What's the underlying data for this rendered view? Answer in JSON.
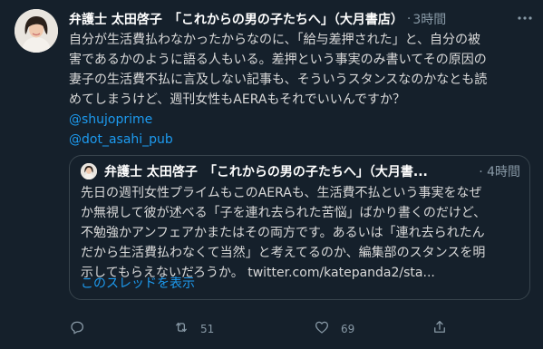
{
  "tweet": {
    "author": {
      "name": "弁護士 太田啓子　「これからの男の子たちへ」（大月書店）",
      "handle": "·",
      "time": "3時間"
    },
    "body_lines": [
      "自分が生活費払わなかったからなのに、「給与差押された」と、自分の被",
      "害であるかのように語る人もいる。差押という事実のみ書いてその原因の",
      "妻子の生活費不払に言及しない記事も、そういうスタンスなのかなとも読",
      "めてしまうけど、週刊女性もAERAもそれでいいんですか？"
    ],
    "mentions": [
      "@shujoprime",
      "@dot_asahi_pub"
    ],
    "quote": {
      "author_name": "弁護士 太田啓子　「これからの男の子たちへ」（大月書...",
      "time": "· 4時間",
      "body_lines": [
        "先日の週刊女性プライムもこのAERAも、生活費不払という事実をなぜ",
        "か無視して彼が述べる「子を連れ去られた苦悩」ばかり書くのだけど、",
        "不勉強かアンフェアかまたはその両方です。あるいは「連れ去られたん",
        "だから生活費払わなくて当然」と考えてるのか、編集部のスタンスを明",
        "示してもらえないだろうか。 twitter.com/katepanda2/sta..."
      ],
      "thread_link": "このスレッドを表示"
    },
    "actions": {
      "reply_count": "",
      "retweet_count": "51",
      "like_count": "69"
    }
  },
  "colors": {
    "background": "#15202b",
    "text": "#d9d9d9",
    "secondary": "#8899a6",
    "link": "#1d9bf0",
    "border": "#38444d"
  },
  "icons": [
    "more-icon",
    "reply-icon",
    "retweet-icon",
    "like-icon",
    "share-icon"
  ]
}
